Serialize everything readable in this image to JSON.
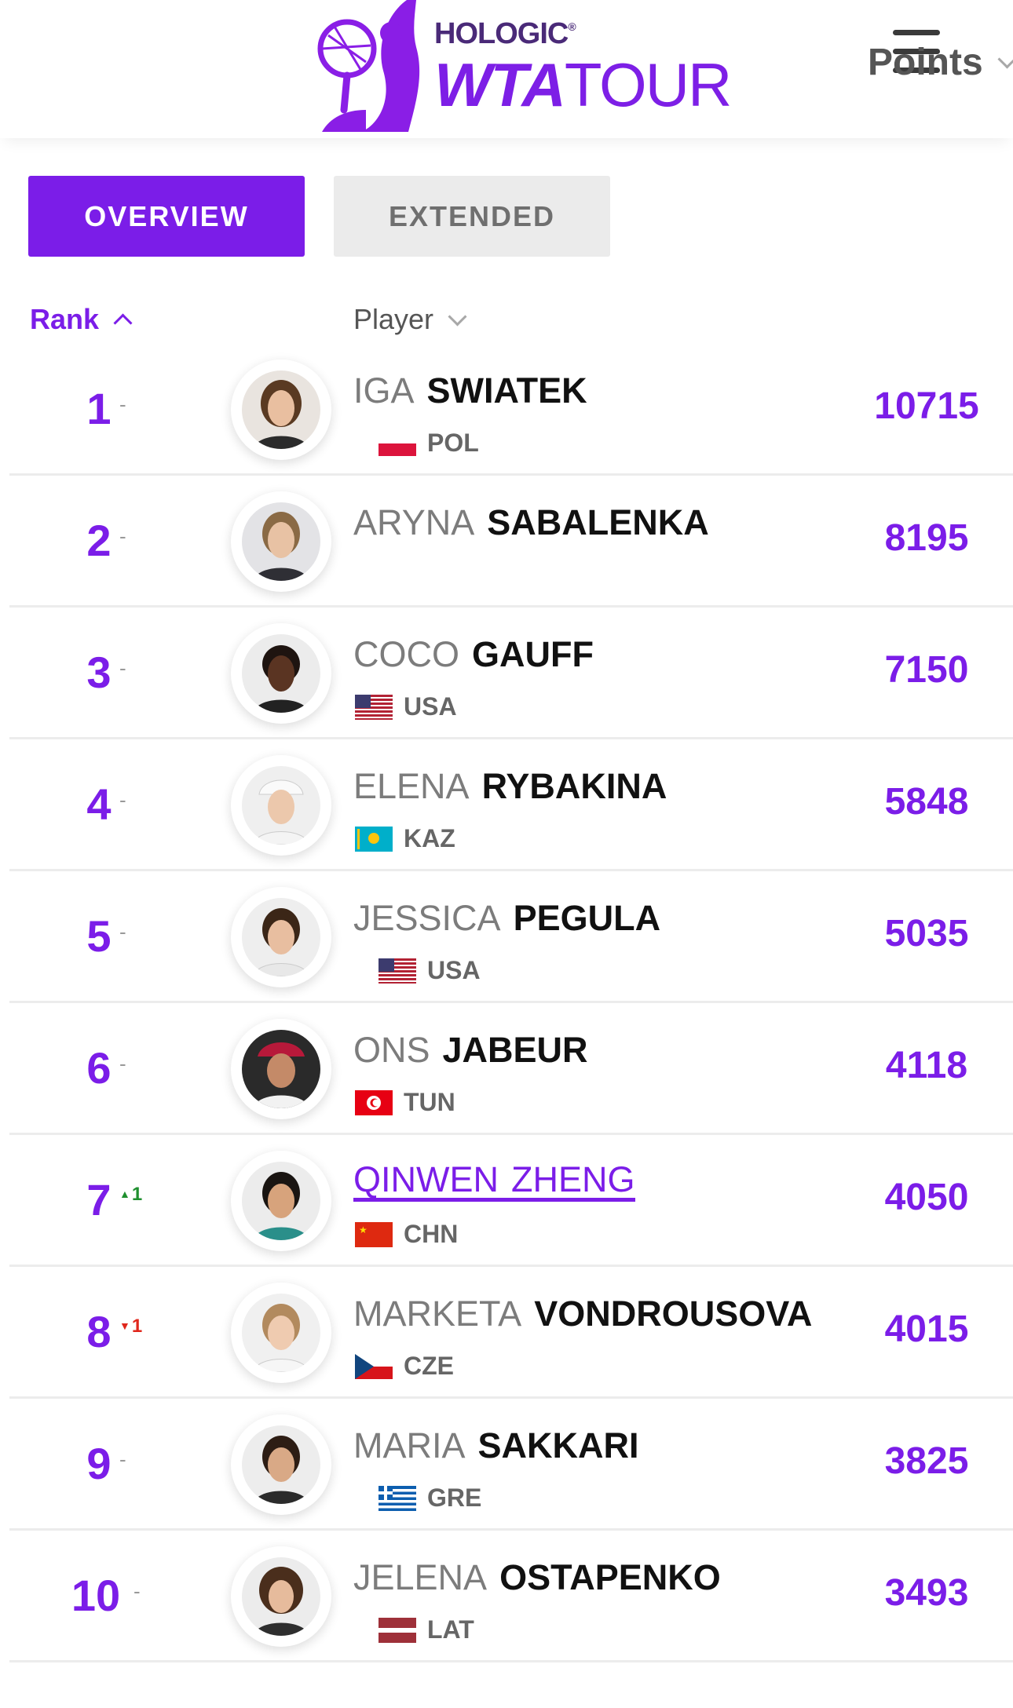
{
  "header": {
    "logo_top": "HOLOGIC",
    "logo_reg": "®",
    "logo_wta": "WTA",
    "logo_tour": "TOUR"
  },
  "tabs": [
    {
      "label": "OVERVIEW",
      "active": true
    },
    {
      "label": "EXTENDED",
      "active": false
    }
  ],
  "columns": {
    "rank": "Rank",
    "player": "Player",
    "points": "Points"
  },
  "rows": [
    {
      "rank": "1",
      "movement": "-",
      "first": "IGA",
      "last": "SWIATEK",
      "country": "POL",
      "points": "10715"
    },
    {
      "rank": "2",
      "movement": "-",
      "first": "ARYNA",
      "last": "SABALENKA",
      "country": "",
      "points": "8195"
    },
    {
      "rank": "3",
      "movement": "-",
      "first": "COCO",
      "last": "GAUFF",
      "country": "USA",
      "points": "7150"
    },
    {
      "rank": "4",
      "movement": "-",
      "first": "ELENA",
      "last": "RYBAKINA",
      "country": "KAZ",
      "points": "5848"
    },
    {
      "rank": "5",
      "movement": "-",
      "first": "JESSICA",
      "last": "PEGULA",
      "country": "USA",
      "points": "5035"
    },
    {
      "rank": "6",
      "movement": "-",
      "first": "ONS",
      "last": "JABEUR",
      "country": "TUN",
      "points": "4118"
    },
    {
      "rank": "7",
      "movement": "1",
      "first": "QINWEN",
      "last": "ZHENG",
      "country": "CHN",
      "points": "4050"
    },
    {
      "rank": "8",
      "movement": "1",
      "first": "MARKETA",
      "last": "VONDROUSOVA",
      "country": "CZE",
      "points": "4015"
    },
    {
      "rank": "9",
      "movement": "-",
      "first": "MARIA",
      "last": "SAKKARI",
      "country": "GRE",
      "points": "3825"
    },
    {
      "rank": "10",
      "movement": "-",
      "first": "JELENA",
      "last": "OSTAPENKO",
      "country": "LAT",
      "points": "3493"
    }
  ],
  "colors": {
    "accent": "#7b1de8",
    "up": "#1f8f2e",
    "down": "#e0271c"
  }
}
